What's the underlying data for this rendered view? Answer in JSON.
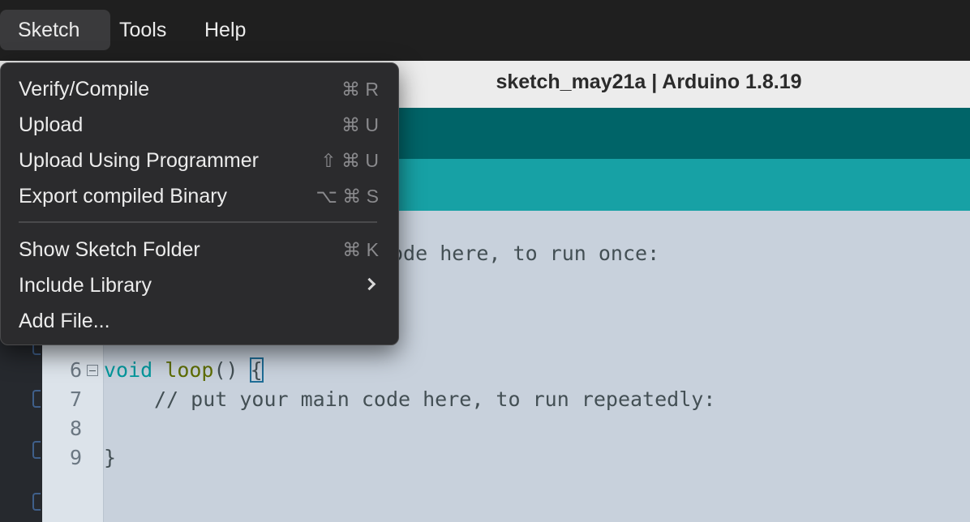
{
  "menubar": {
    "items": [
      {
        "label": "Sketch"
      },
      {
        "label": "Tools"
      },
      {
        "label": "Help"
      }
    ]
  },
  "window": {
    "title": "sketch_may21a | Arduino 1.8.19"
  },
  "sketch_menu": {
    "items": [
      {
        "label": "Verify/Compile",
        "shortcut": "⌘ R"
      },
      {
        "label": "Upload",
        "shortcut": "⌘ U"
      },
      {
        "label": "Upload Using Programmer",
        "shortcut": "⇧ ⌘ U"
      },
      {
        "label": "Export compiled Binary",
        "shortcut": "⌥ ⌘ S"
      },
      {
        "label": "Show Sketch Folder",
        "shortcut": "⌘ K"
      },
      {
        "label": "Include Library",
        "shortcut": "",
        "submenu": true
      },
      {
        "label": "Add File...",
        "shortcut": ""
      }
    ]
  },
  "editor": {
    "line_numbers": [
      "6",
      "7",
      "8",
      "9"
    ],
    "visible_fragment": "ode here, to run once:",
    "loop_type": "void",
    "loop_name": "loop",
    "loop_parens": "()",
    "loop_brace": "{",
    "comment": "// put your main code here, to run repeatedly:",
    "closing_brace": "}"
  },
  "colors": {
    "toolbar": "#006468",
    "tabbar": "#17a1a5",
    "editor_bg": "#c8d1dc",
    "keyword_type": "#00979c",
    "keyword_func": "#5e6d03"
  }
}
